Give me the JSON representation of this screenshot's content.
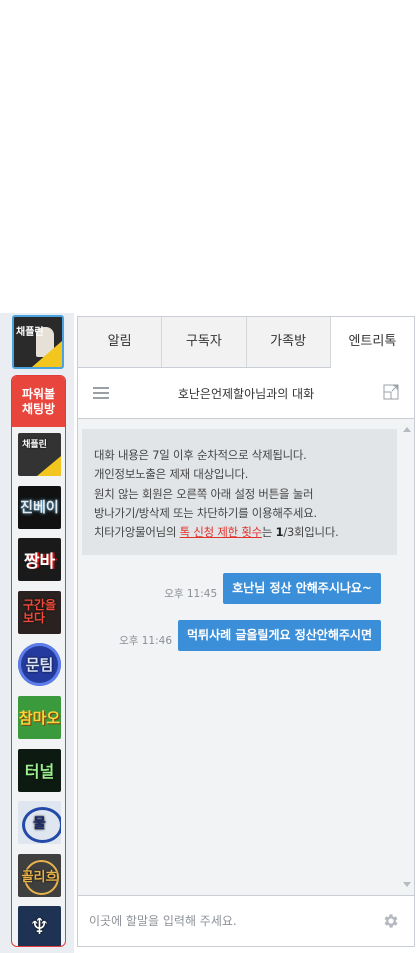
{
  "rail": {
    "top_channel": {
      "label": "채플린",
      "icon": "channel-thumbnail"
    },
    "power_header": "파워볼\n채팅방",
    "channels": [
      {
        "label": "채플린"
      },
      {
        "label": "진베이"
      },
      {
        "label": "짱바"
      },
      {
        "label": "구간을\n보다"
      },
      {
        "label": "문팀"
      },
      {
        "label": "참마오"
      },
      {
        "label": "터널"
      },
      {
        "label": "물"
      },
      {
        "label": "골리흐"
      },
      {
        "label": "♆"
      }
    ]
  },
  "tabs": [
    {
      "label": "알림",
      "active": false
    },
    {
      "label": "구독자",
      "active": false
    },
    {
      "label": "가족방",
      "active": false
    },
    {
      "label": "엔트리톡",
      "active": true
    }
  ],
  "chat": {
    "title": "호난은언제할아님과의 대화",
    "notice": {
      "line1": "대화 내용은 7일 이후 순차적으로 삭제됩니다.",
      "line2": "개인정보노출은 제재 대상입니다.",
      "line3": "원치 않는 회원은 오른쪽 아래 설정 버튼을 눌러",
      "line4": "방나가기/방삭제 또는 차단하기를 이용해주세요.",
      "line5_prefix": "치타가앙물어님의 ",
      "line5_link": "톡 신청 제한 횟수",
      "line5_middle": "는 ",
      "line5_count": "1",
      "line5_suffix": "/3회입니다."
    },
    "messages": [
      {
        "time": "오후 11:45",
        "text": "호난님 정산 안해주시나요~"
      },
      {
        "time": "오후 11:46",
        "text": "먹튀사례 글올릴게요 정산안해주시면"
      }
    ],
    "input_placeholder": "이곳에 할말을 입력해 주세요."
  },
  "colors": {
    "bubble": "#3b8fd9",
    "power_header": "#e8453c",
    "warn_link": "#e0322b",
    "active_tab": "#ffffff"
  }
}
